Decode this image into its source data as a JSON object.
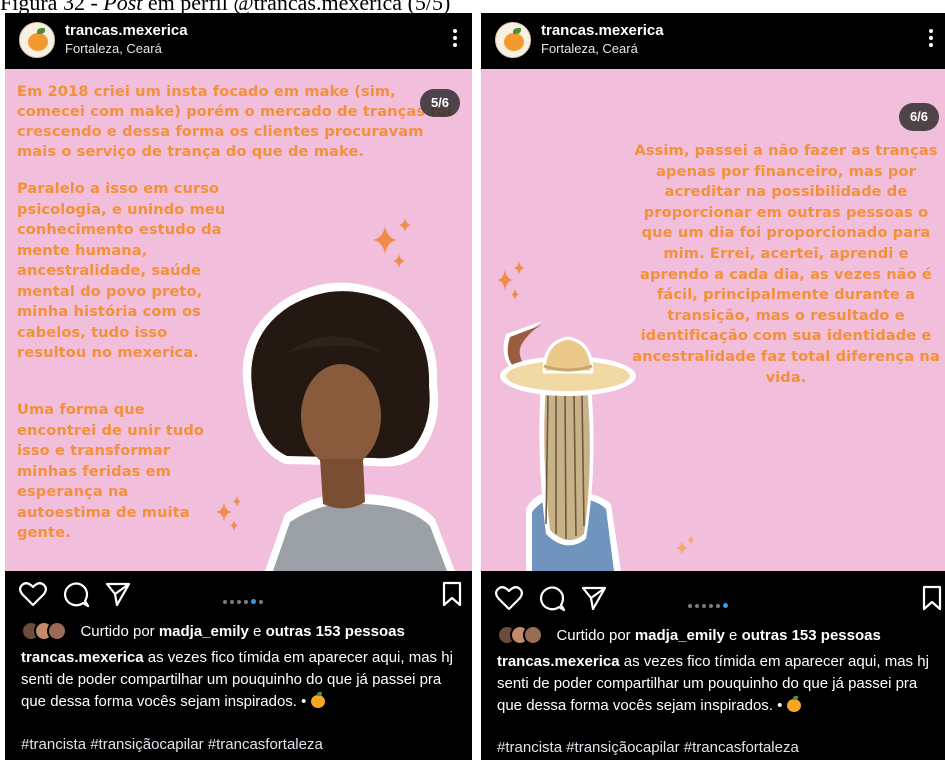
{
  "figure_caption": {
    "prefix": "Figura 32 - ",
    "italic": "Post",
    "suffix": " em perfil @trancas.mexerica (5/5)"
  },
  "posts": [
    {
      "username": "trancas.mexerica",
      "location": "Fortaleza, Ceará",
      "slide_counter": "5/6",
      "slide_text_top": "Em 2018 criei um insta focado em make (sim, comecei com make) porém o mercado de tranças foi crescendo e dessa forma os clientes procuravam mais o serviço de trança do que de make.",
      "slide_text_mid": "Paralelo a isso em curso psicologia, e unindo meu conhecimento estudo da mente humana, ancestralidade, saúde mental do povo preto, minha história com os cabelos, tudo isso resultou no mexerica.",
      "slide_text_bottom": "Uma forma que encontrei de unir tudo isso e transformar minhas feridas em esperança na autoestima de muita gente.",
      "carousel_active": 4,
      "likes": {
        "prefix": "Curtido por ",
        "user": "madja_emily",
        "mid": " e ",
        "others": "outras 153 pessoas"
      },
      "caption": {
        "user": "trancas.mexerica",
        "text": " as vezes fico tímida em aparecer aqui, mas hj senti de poder compartilhar um pouquinho do que já passei pra que dessa forma vocês sejam inspirados. • "
      },
      "hashtags": "#trancista #transiçãocapilar #trancasfortaleza"
    },
    {
      "username": "trancas.mexerica",
      "location": "Fortaleza, Ceará",
      "slide_counter": "6/6",
      "slide_text": "Assim, passei a não fazer as tranças apenas por financeiro, mas por acreditar na possibilidade de proporcionar em outras pessoas o que um dia foi proporcionado para mim. Errei, acertei, aprendi e aprendo a cada dia, as vezes não é fácil, principalmente durante a transição, mas o resultado e identificação com sua identidade e ancestralidade faz total diferença na vida.",
      "carousel_active": 5,
      "likes": {
        "prefix": "Curtido por ",
        "user": "madja_emily",
        "mid": " e ",
        "others": "outras 153 pessoas"
      },
      "caption": {
        "user": "trancas.mexerica",
        "text": " as vezes fico tímida em aparecer aqui, mas hj senti de poder compartilhar um pouquinho do que já passei pra que dessa forma vocês sejam inspirados. • "
      },
      "hashtags": "#trancista #transiçãocapilar #trancasfortaleza"
    }
  ],
  "colors": {
    "slide_bg": "#f1bedc",
    "slide_text": "#f3903a",
    "app_bg": "#000000",
    "active_dot": "#3897f0"
  },
  "icons": [
    "more-options-icon",
    "heart-icon",
    "comment-icon",
    "share-icon",
    "bookmark-icon",
    "sparkle-icon",
    "orange-emoji-icon"
  ]
}
